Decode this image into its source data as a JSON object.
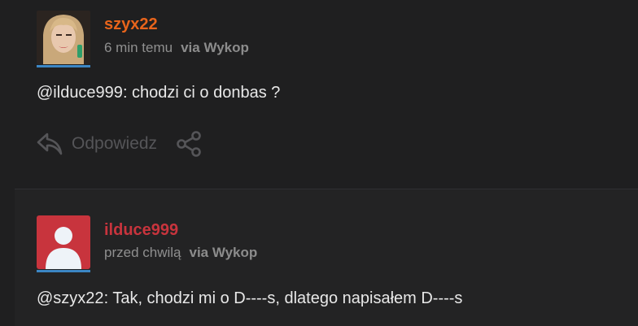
{
  "comments": [
    {
      "username": "szyx22",
      "username_color": "#e8641b",
      "time": "6 min temu",
      "source": "via Wykop",
      "mention": "@ilduce999",
      "text": ": chodzi ci o donbas ?",
      "avatar_icon": "user-photo",
      "reply_label": "Odpowiedz"
    },
    {
      "username": "ilduce999",
      "username_color": "#c8343d",
      "time": "przed chwilą",
      "source": "via Wykop",
      "mention": "@szyx22",
      "text": ": Tak, chodzi mi o D----s, dlatego napisałem D----s",
      "avatar_icon": "default-user-icon"
    }
  ]
}
